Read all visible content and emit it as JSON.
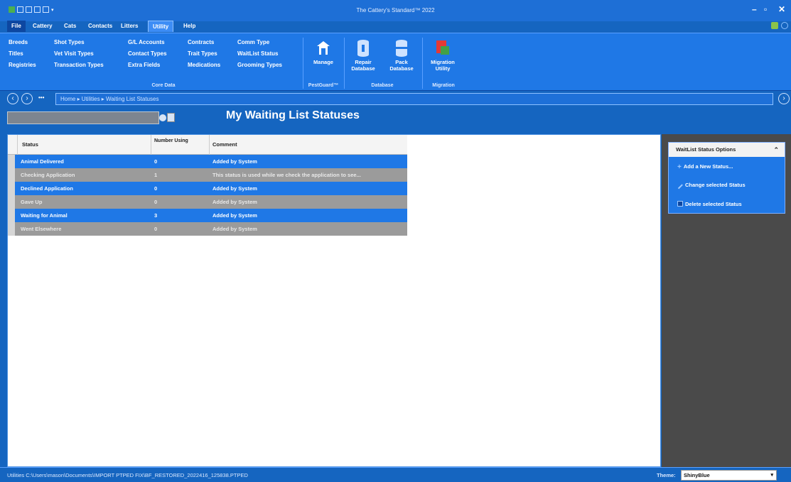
{
  "window": {
    "title": "The Cattery's Standard™ 2022",
    "minimize": "–",
    "restore": "▫",
    "close": "✕"
  },
  "menu": {
    "tabs": [
      "File",
      "Cattery",
      "Cats",
      "Contacts",
      "Litters",
      "Utility",
      "Help"
    ],
    "active": "Utility"
  },
  "ribbon": {
    "col1": [
      "Breeds",
      "Titles",
      "Registries"
    ],
    "col2": [
      "Shot Types",
      "Vet Visit Types",
      "Transaction Types"
    ],
    "col3": [
      "G/L Accounts",
      "Contact Types",
      "Extra Fields"
    ],
    "col4": [
      "Contracts",
      "Trait Types",
      "Medications"
    ],
    "col5": [
      "Comm Type",
      "WaitList Status",
      "Grooming Types"
    ],
    "group_core": "Core Data",
    "manage_label": "Manage",
    "group_pestguard": "PestGuard™",
    "repair_label": "Repair Database",
    "pack_label": "Pack Database",
    "group_database": "Database",
    "migration_label": "Migration Utility",
    "group_migration": "Migration"
  },
  "nav": {
    "back": "‹",
    "forward": "›",
    "more": "•••",
    "breadcrumb": "Home ▸ Utilities ▸ Waiting List Statuses",
    "end": "›"
  },
  "page": {
    "title": "My Waiting List Statuses"
  },
  "grid": {
    "columns": [
      "Status",
      "Number Using",
      "Comment"
    ],
    "rows": [
      {
        "status": "Animal Delivered",
        "number": "0",
        "comment": "Added by System",
        "style": "blue"
      },
      {
        "status": "Checking Application",
        "number": "1",
        "comment": "This status is used while we check the application to see...",
        "style": "gray"
      },
      {
        "status": "Declined Application",
        "number": "0",
        "comment": "Added by System",
        "style": "blue"
      },
      {
        "status": "Gave Up",
        "number": "0",
        "comment": "Added by System",
        "style": "gray"
      },
      {
        "status": "Waiting for Animal",
        "number": "3",
        "comment": "Added by System",
        "style": "blue"
      },
      {
        "status": "Went Elsewhere",
        "number": "0",
        "comment": "Added by System",
        "style": "gray"
      }
    ]
  },
  "side": {
    "title": "WaitList Status Options",
    "chevron": "⌃",
    "links": [
      "Add a New Status...",
      "Change selected Status",
      "Delete selected Status"
    ]
  },
  "status": {
    "path": "Utilities  C:\\Users\\mason\\Documents\\IMPORT PTPED FIX\\BF_RESTORED_2022416_125838.PTPED",
    "theme_label": "Theme:",
    "theme_value": "ShinyBlue"
  },
  "colors": {
    "accent": "#1f78e6",
    "row_gray": "#9b9b9b",
    "panel_bg": "#4a4a4a"
  }
}
